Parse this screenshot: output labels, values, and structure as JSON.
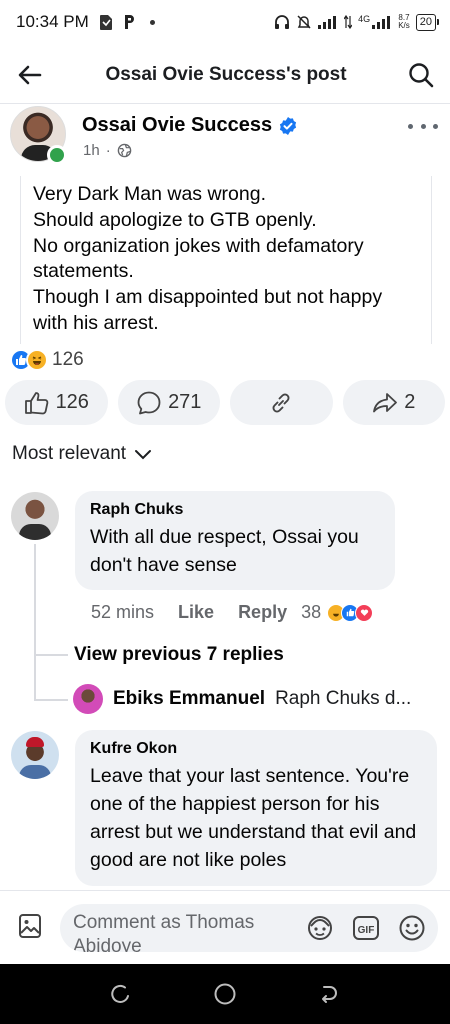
{
  "status_bar": {
    "time": "10:34 PM",
    "network": "4G",
    "speed_value": "8.7",
    "speed_unit": "K/s",
    "battery": "20"
  },
  "header": {
    "title": "Ossai Ovie Success's post"
  },
  "post": {
    "author": "Ossai Ovie Success",
    "time": "1h",
    "lines": [
      "Very Dark Man was wrong.",
      "Should apologize to GTB openly.",
      "No organization jokes with defamatory statements.",
      "Though I am disappointed but not happy with his arrest."
    ],
    "reaction_count": "126"
  },
  "actions": {
    "like_count": "126",
    "comment_count": "271",
    "share_count": "2"
  },
  "sort_label": "Most relevant",
  "comments": [
    {
      "author": "Raph Chuks",
      "text": "With all due respect, Ossai you don't have sense",
      "time": "52 mins",
      "like_label": "Like",
      "reply_label": "Reply",
      "reaction_count": "38"
    },
    {
      "author": "Kufre Okon",
      "text": "Leave that your last sentence. You're one of the happiest person for his arrest but we understand that evil and good are not like poles"
    }
  ],
  "replies": {
    "view_previous": "View previous 7 replies",
    "preview_author": "Ebiks Emmanuel",
    "preview_text": "Raph Chuks d..."
  },
  "composer": {
    "placeholder": "Comment as Thomas Abidoye"
  },
  "colors": {
    "facebook_blue": "#1877f2",
    "online_green": "#31a24c",
    "bubble_gray": "#f0f2f5"
  },
  "icons": [
    "back-arrow-icon",
    "search-icon",
    "verified-badge-icon",
    "globe-icon",
    "like-icon",
    "comment-icon",
    "link-icon",
    "share-icon",
    "chevron-down-icon",
    "photo-icon",
    "avatar-sticker-icon",
    "gif-icon",
    "emoji-icon"
  ]
}
